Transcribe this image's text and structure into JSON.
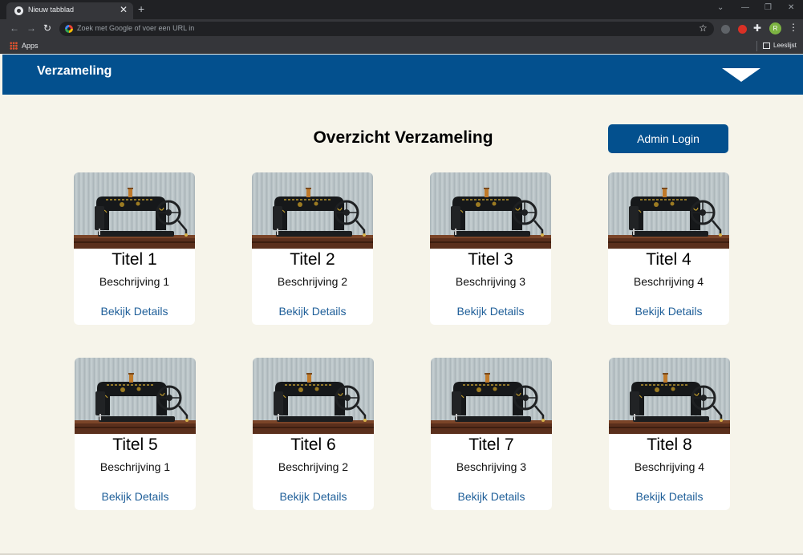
{
  "browser": {
    "tab_title": "Nieuw tabblad",
    "omnibox_placeholder": "Zoek met Google of voer een URL in",
    "avatar_initial": "R",
    "bookmarks": {
      "apps_label": "Apps",
      "reading_list_label": "Leeslijst"
    }
  },
  "app": {
    "brand": "Verzameling",
    "page_title": "Overzicht Verzameling",
    "admin_button": "Admin Login",
    "colors": {
      "primary": "#03508e",
      "background": "#f6f4ea",
      "link": "#1f5f99"
    },
    "cards": [
      {
        "title": "Titel 1",
        "description": "Beschrijving 1",
        "link": "Bekijk Details"
      },
      {
        "title": "Titel 2",
        "description": "Beschrijving 2",
        "link": "Bekijk Details"
      },
      {
        "title": "Titel 3",
        "description": "Beschrijving 3",
        "link": "Bekijk Details"
      },
      {
        "title": "Titel 4",
        "description": "Beschrijving 4",
        "link": "Bekijk Details"
      },
      {
        "title": "Titel 5",
        "description": "Beschrijving 1",
        "link": "Bekijk Details"
      },
      {
        "title": "Titel 6",
        "description": "Beschrijving 2",
        "link": "Bekijk Details"
      },
      {
        "title": "Titel 7",
        "description": "Beschrijving 3",
        "link": "Bekijk Details"
      },
      {
        "title": "Titel 8",
        "description": "Beschrijving 4",
        "link": "Bekijk Details"
      }
    ]
  }
}
